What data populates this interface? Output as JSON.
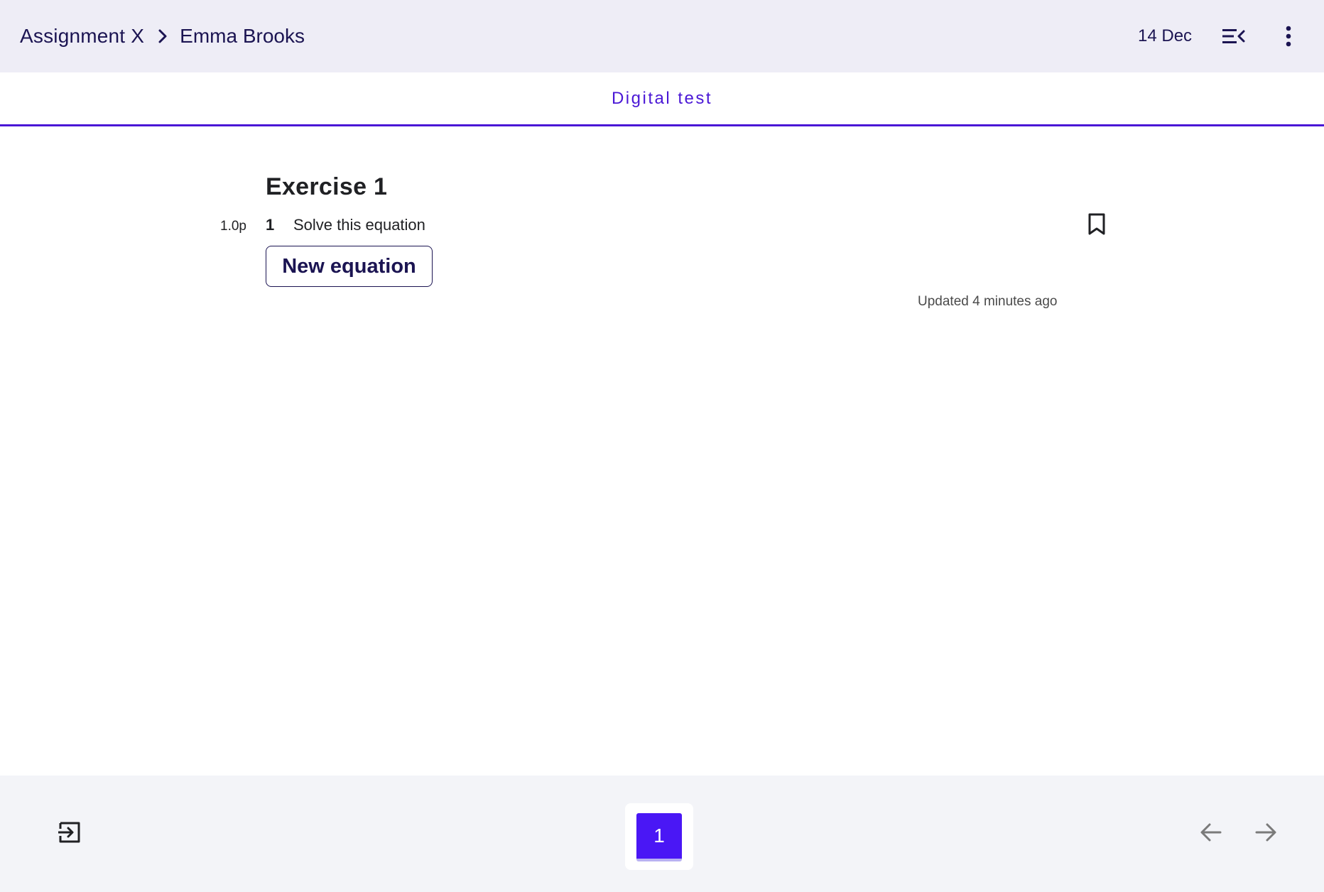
{
  "header": {
    "assignment": "Assignment X",
    "student": "Emma Brooks",
    "date": "14 Dec",
    "icons": {
      "separator": "chevron-right-icon",
      "panel_toggle": "collapse-menu-icon",
      "more": "more-vertical-icon"
    }
  },
  "tabs": [
    {
      "label": "Digital test",
      "active": true
    }
  ],
  "exercise": {
    "title": "Exercise 1",
    "question": {
      "points": "1.0p",
      "number": "1",
      "text": "Solve this equation"
    },
    "new_equation_label": "New equation",
    "updated": "Updated 4 minutes ago",
    "bookmark_icon": "bookmark-icon"
  },
  "footer": {
    "pages": [
      "1"
    ],
    "current_page": "1",
    "icons": {
      "exit": "exit-icon",
      "prev": "arrow-left-icon",
      "next": "arrow-right-icon"
    }
  },
  "colors": {
    "accent": "#4a17d6",
    "page_active": "#4a17f5",
    "header_bg": "#eeedf6",
    "footer_bg": "#f3f4f8",
    "text_dark": "#1b1452"
  }
}
